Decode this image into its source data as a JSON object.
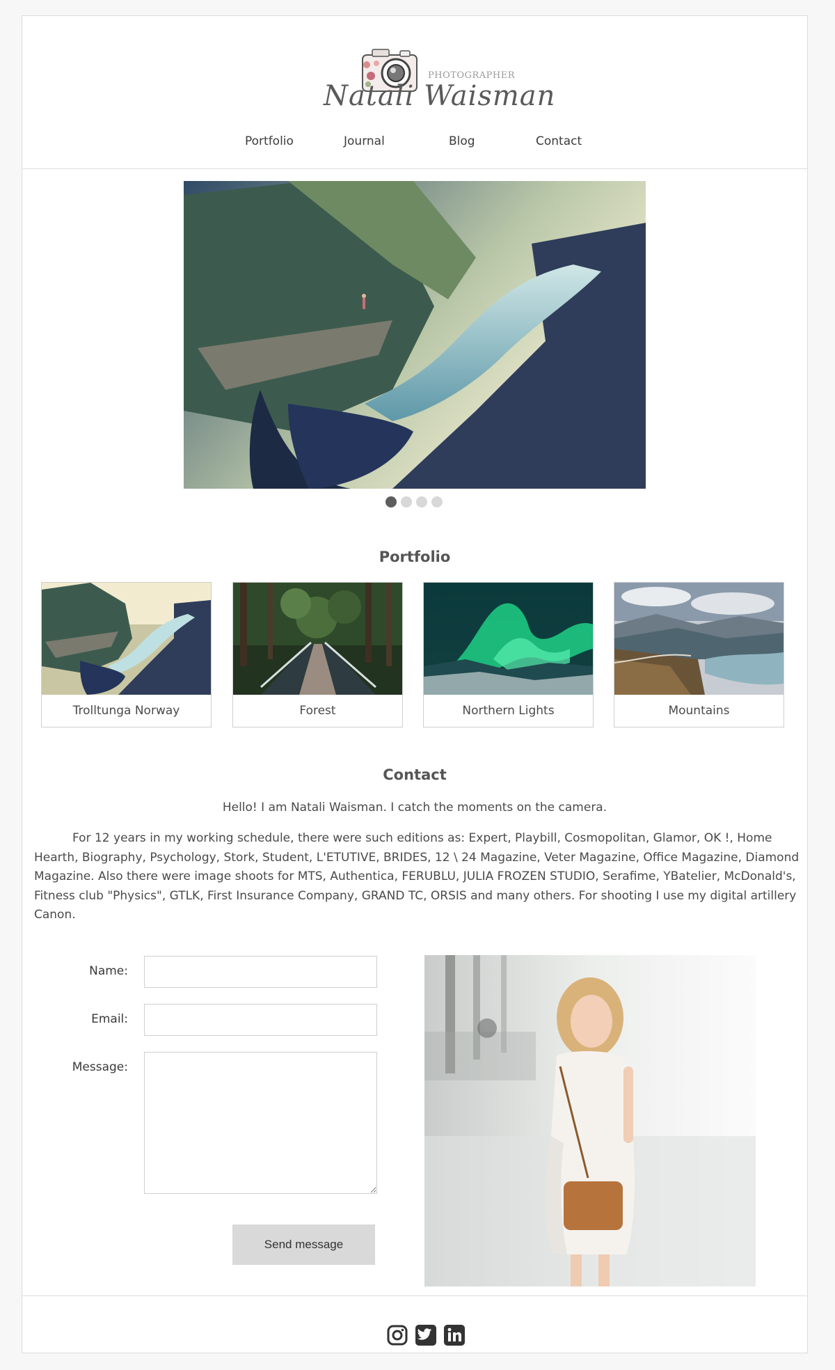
{
  "brand": {
    "tagline": "PHOTOGRAPHER",
    "name": "Natali Waisman"
  },
  "nav": {
    "items": [
      {
        "label": "Portfolio"
      },
      {
        "label": "Journal"
      },
      {
        "label": "Blog"
      },
      {
        "label": "Contact"
      }
    ]
  },
  "slider": {
    "slide_count": 4,
    "active_index": 0
  },
  "portfolio": {
    "title": "Portfolio",
    "items": [
      {
        "caption": "Trolltunga Norway"
      },
      {
        "caption": "Forest"
      },
      {
        "caption": "Northern Lights"
      },
      {
        "caption": "Mountains"
      }
    ]
  },
  "contact": {
    "title": "Contact",
    "intro": "Hello! I am Natali Waisman. I catch the moments on the camera.",
    "bio": "For 12 years in my working schedule, there were such editions as: Expert, Playbill, Cosmopolitan, Glamor, OK !, Home Hearth, Biography, Psychology, Stork, Student, L'ETUTIVE, BRIDES, 12 \\ 24 Magazine, Veter Magazine, Office Magazine, Diamond Magazine. Also there were image shoots for MTS, Authentica, FERUBLU, JULIA FROZEN STUDIO, Serafime, YBatelier, McDonald's, Fitness club \"Physics\", GTLK, First Insurance Company, GRAND TC, ORSIS and many others. For shooting I use my digital artillery Canon.",
    "form": {
      "name_label": "Name:",
      "name_value": "",
      "email_label": "Email:",
      "email_value": "",
      "message_label": "Message:",
      "message_value": "",
      "send_label": "Send message"
    }
  },
  "footer": {
    "social": [
      "instagram-icon",
      "twitter-icon",
      "linkedin-icon"
    ]
  },
  "colors": {
    "text": "#4d4d4d",
    "border": "#dcdcdc",
    "button_bg": "#d9d9d9",
    "dot_active": "#5d5d5d",
    "dot_inactive": "#d8d8d8"
  }
}
